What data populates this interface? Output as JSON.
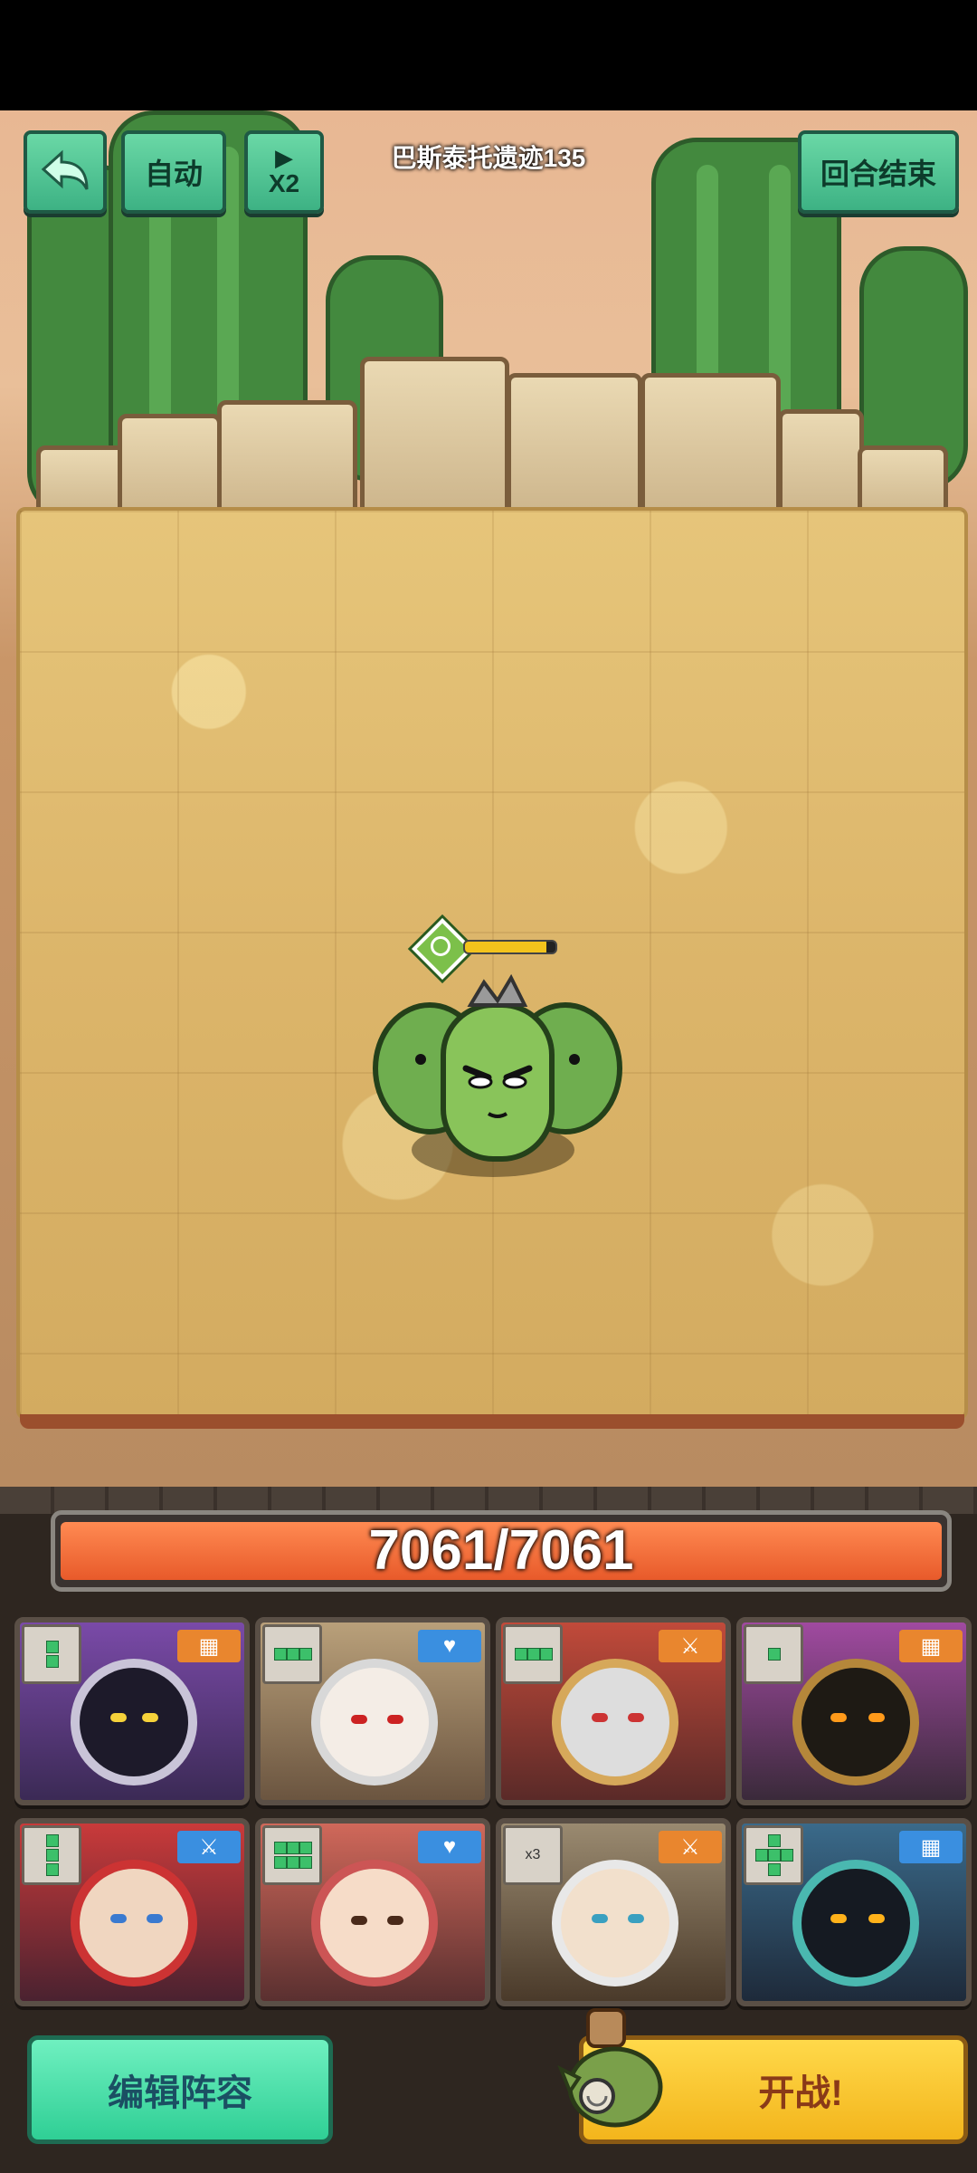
{
  "header": {
    "back_label": "",
    "auto_label": "自动",
    "speed_label": "X2",
    "stage_title": "巴斯泰托遗迹135",
    "end_turn_label": "回合结束"
  },
  "enemy": {
    "name": "cactus-monster",
    "hp_fraction": 0.9
  },
  "boss_hp": {
    "text": "7061/7061",
    "fraction": 1.0
  },
  "heroes": [
    {
      "name": "hero-1",
      "shape": "1x2",
      "role": "tank",
      "role_color": "#e9862e",
      "role_icon": "▦"
    },
    {
      "name": "hero-2",
      "shape": "3x1",
      "role": "healer",
      "role_color": "#3a8fe0",
      "role_icon": "♥"
    },
    {
      "name": "hero-3",
      "shape": "3x1",
      "role": "warrior",
      "role_color": "#e9862e",
      "role_icon": "⚔"
    },
    {
      "name": "hero-4",
      "shape": "1x1",
      "role": "tank",
      "role_color": "#e9862e",
      "role_icon": "▦"
    },
    {
      "name": "hero-5",
      "shape": "1x3",
      "role": "warrior",
      "role_color": "#3a8fe0",
      "role_icon": "⚔"
    },
    {
      "name": "hero-6",
      "shape": "3x2",
      "role": "healer",
      "role_color": "#3a8fe0",
      "role_icon": "♥"
    },
    {
      "name": "hero-7",
      "shape": "x3",
      "role": "warrior",
      "role_color": "#e9862e",
      "role_icon": "⚔"
    },
    {
      "name": "hero-8",
      "shape": "plus",
      "role": "tank",
      "role_color": "#3a8fe0",
      "role_icon": "▦"
    }
  ],
  "shape_badge_text": {
    "hero7": "x3"
  },
  "footer": {
    "edit_label": "编辑阵容",
    "start_label": "开战!"
  },
  "colors": {
    "accent_green": "#3db284",
    "accent_yellow": "#f3b51c",
    "hp_orange": "#e85a2a"
  }
}
